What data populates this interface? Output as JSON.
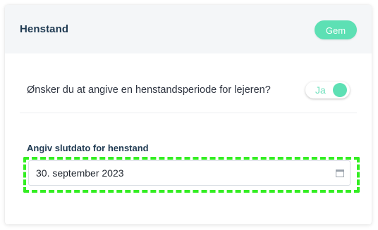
{
  "header": {
    "title": "Henstand",
    "save_label": "Gem"
  },
  "question": {
    "text": "Ønsker du at angive en henstandsperiode for lejeren?",
    "toggle_label": "Ja",
    "toggle_on": true
  },
  "date_field": {
    "label": "Angiv slutdato for henstand",
    "value": "30. september 2023",
    "icon": "calendar-icon"
  },
  "colors": {
    "accent": "#5de0b4",
    "title": "#1f3a52",
    "highlight": "#33ee22",
    "header_bg": "#f4f6f8"
  }
}
